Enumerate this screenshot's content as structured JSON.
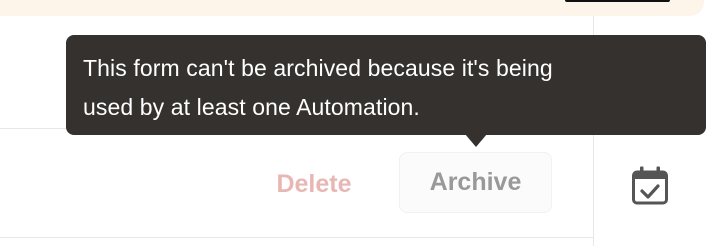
{
  "tooltip": {
    "line1": "This form can't be archived because it's being",
    "line2": "used by at least one Automation."
  },
  "actions": {
    "delete_label": "Delete",
    "archive_label": "Archive"
  },
  "icons": {
    "side_icon": "calendar-check-icon"
  },
  "colors": {
    "tooltip_bg": "#34312e",
    "delete_text": "#e8b7b4",
    "archive_text": "#999999",
    "banner_bg": "#fdf5ea"
  }
}
